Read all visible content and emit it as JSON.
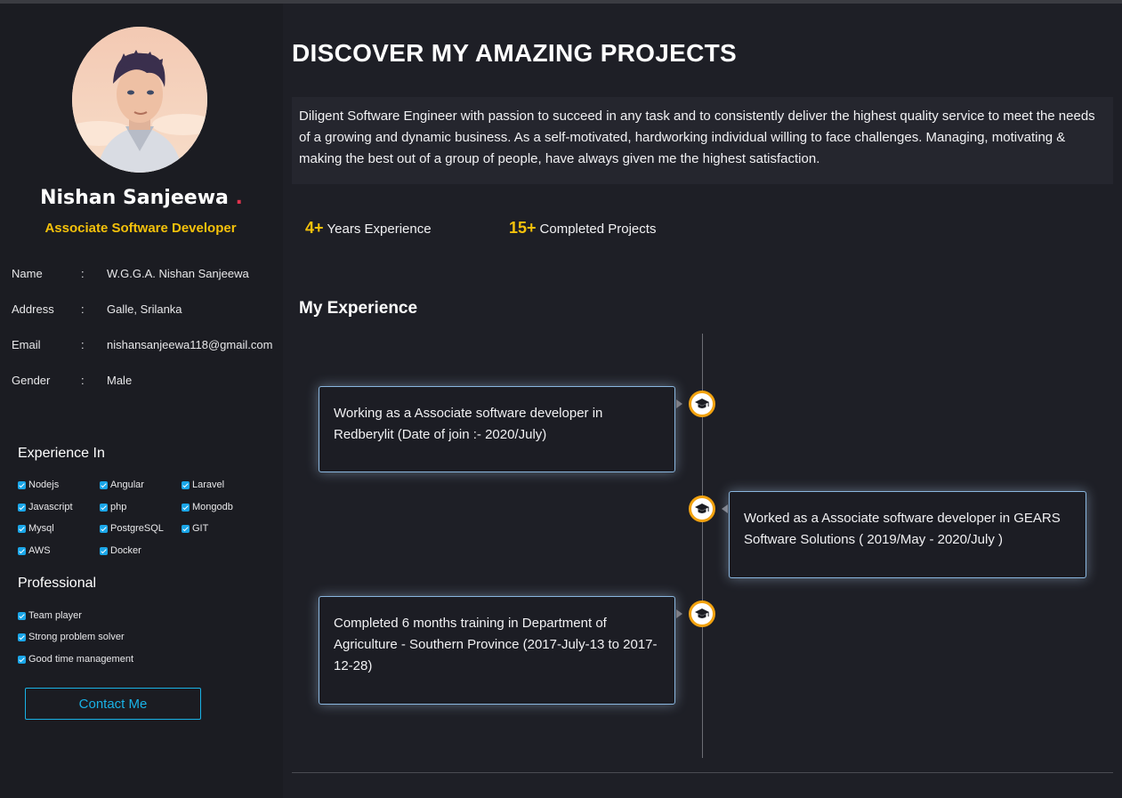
{
  "profile": {
    "name": "Nishan Sanjeewa",
    "name_dot": ".",
    "role": "Associate Software Developer"
  },
  "info": [
    {
      "key": "Name",
      "sep": ":",
      "value": "W.G.G.A. Nishan Sanjeewa"
    },
    {
      "key": "Address",
      "sep": ":",
      "value": "Galle, Srilanka"
    },
    {
      "key": "Email",
      "sep": ":",
      "value": "nishansanjeewa118@gmail.com"
    },
    {
      "key": "Gender",
      "sep": ":",
      "value": "Male"
    }
  ],
  "experience_in": {
    "title": "Experience In",
    "items": [
      "Nodejs",
      "Angular",
      "Laravel",
      "Javascript",
      "php",
      "Mongodb",
      "Mysql",
      "PostgreSQL",
      "GIT",
      "AWS",
      "Docker"
    ]
  },
  "professional": {
    "title": "Professional",
    "items": [
      "Team player",
      "Strong problem solver",
      "Good time management"
    ]
  },
  "contact_button": "Contact Me",
  "main": {
    "title": "DISCOVER MY AMAZING PROJECTS",
    "about": "Diligent Software Engineer with passion to succeed in any task and to consistently deliver the highest quality service to meet the needs of a growing and dynamic business. As a self-motivated, hardworking individual willing to face challenges. Managing, motivating & making the best out of a group of people, have always given me the highest satisfaction.",
    "stats": [
      {
        "number": "4+",
        "label": "Years Experience"
      },
      {
        "number": "15+",
        "label": "Completed Projects"
      }
    ],
    "experience_title": "My Experience",
    "timeline": [
      {
        "text": "Working as a Associate software developer in Redberylit (Date of join :- 2020/July)",
        "icon": "graduation-cap-icon"
      },
      {
        "text": "Worked as a Associate software developer in GEARS Software Solutions ( 2019/May - 2020/July )",
        "icon": "graduation-cap-icon"
      },
      {
        "text": "Completed 6 months training in Department of Agriculture - Southern Province (2017-July-13 to 2017-12-28)",
        "icon": "graduation-cap-icon"
      }
    ]
  },
  "colors": {
    "accent_yellow": "#f4c10b",
    "accent_cyan": "#19b2e6",
    "timeline_icon_border": "#f2a20f",
    "name_dot": "#e0334d"
  }
}
